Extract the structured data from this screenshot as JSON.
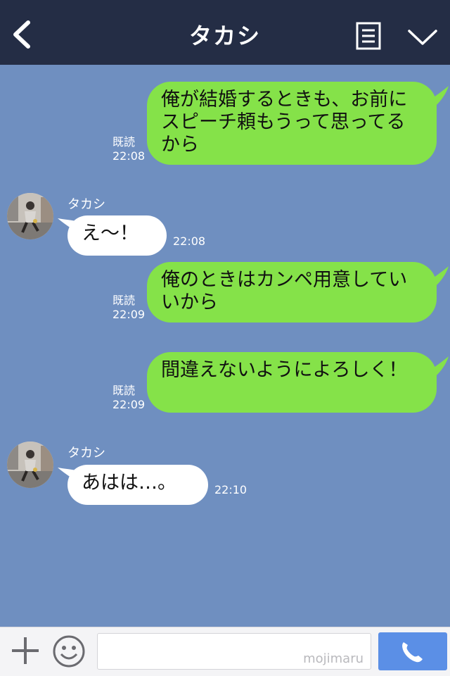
{
  "header": {
    "title": "タカシ",
    "back_icon": "chevron-left-icon",
    "menu_icon": "document-list-icon",
    "collapse_icon": "chevron-down-icon",
    "background": "#242d45"
  },
  "chat": {
    "background": "#6f8fc0",
    "messages": [
      {
        "side": "right",
        "text": "俺が結婚するときも、お前にスピーチ頼もうって思ってるから",
        "read": "既読",
        "time": "22:08"
      },
      {
        "side": "left",
        "sender": "タカシ",
        "text": "え〜！",
        "time": "22:08"
      },
      {
        "side": "right",
        "text": "俺のときはカンペ用意していいから",
        "read": "既読",
        "time": "22:09"
      },
      {
        "side": "right",
        "text": "間違えないようによろしく！",
        "read": "既読",
        "time": "22:09"
      },
      {
        "side": "left",
        "sender": "タカシ",
        "text": "あはは…。",
        "time": "22:10"
      }
    ]
  },
  "footer": {
    "plus_icon": "plus-icon",
    "emoji_icon": "smiley-icon",
    "input_text": "mojimaru",
    "call_icon": "phone-icon",
    "call_color": "#5b8fe6"
  },
  "colors": {
    "sent_bubble": "#85e249",
    "received_bubble": "#ffffff"
  }
}
